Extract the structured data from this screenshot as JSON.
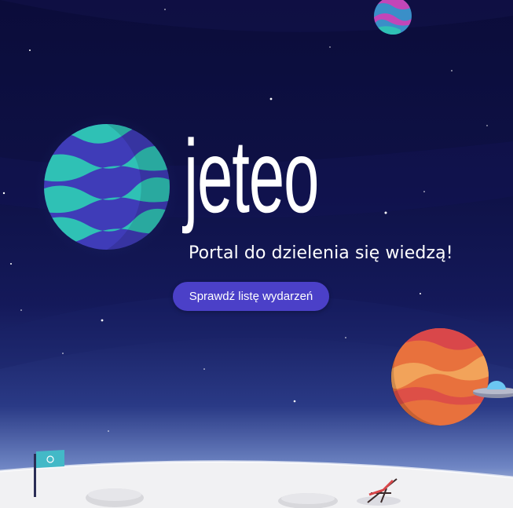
{
  "hero": {
    "brand": "jeteo",
    "tagline": "Portal do dzielenia się wiedzą!",
    "cta_label": "Sprawdź listę wydarzeń"
  },
  "colors": {
    "background": "#0b0c3a",
    "button": "#4b40c8",
    "moon": "#f1f1f3",
    "big_planet_blue": "#3f3cb8",
    "big_planet_teal": "#2fc1b5",
    "orange_planet": "#e8713d"
  },
  "decorations": {
    "big_planet": "striped-planet-icon",
    "small_planet": "small-planet-icon",
    "orange_planet": "orange-planet-icon",
    "ufo": "ufo-icon",
    "flag": "flag-icon",
    "deck_chair": "deck-chair-icon",
    "moon": "moon-surface"
  }
}
